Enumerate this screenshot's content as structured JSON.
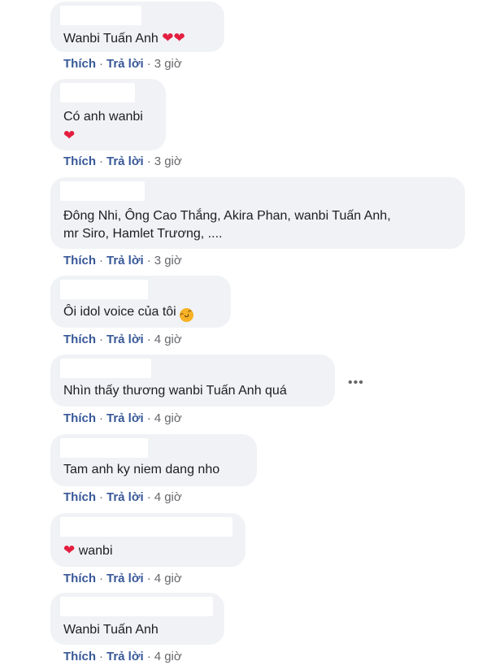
{
  "labels": {
    "like": "Thích",
    "reply": "Trả lời",
    "separator": "·"
  },
  "comments": [
    {
      "text": "Wanbi Tuấn Anh",
      "emoji": "heart-2",
      "time": "3 giờ"
    },
    {
      "text": "Có anh wanbi",
      "emoji": "heart-newline",
      "time": "3 giờ"
    },
    {
      "lines": [
        "Đông Nhi, Ông Cao Thắng, Akira Phan, wanbi Tuấn Anh,",
        "mr Siro, Hamlet Trương, ...."
      ],
      "time": "3 giờ"
    },
    {
      "text": "Ôi idol voice của tôi",
      "emoji": "laugh",
      "time": "4 giờ"
    },
    {
      "text": "Nhìn thấy thương wanbi Tuấn Anh quá",
      "time": "4 giờ"
    },
    {
      "text": "Tam anh ky niem dang nho",
      "time": "4 giờ"
    },
    {
      "text": "wanbi",
      "emoji": "heart-before",
      "time": "4 giờ"
    },
    {
      "text": "Wanbi Tuấn Anh",
      "time": "4 giờ"
    }
  ],
  "more_icon": "ellipsis-icon",
  "colors": {
    "bubble": "#f0f2f5",
    "link": "#385898",
    "heart": "#e41e3f"
  }
}
